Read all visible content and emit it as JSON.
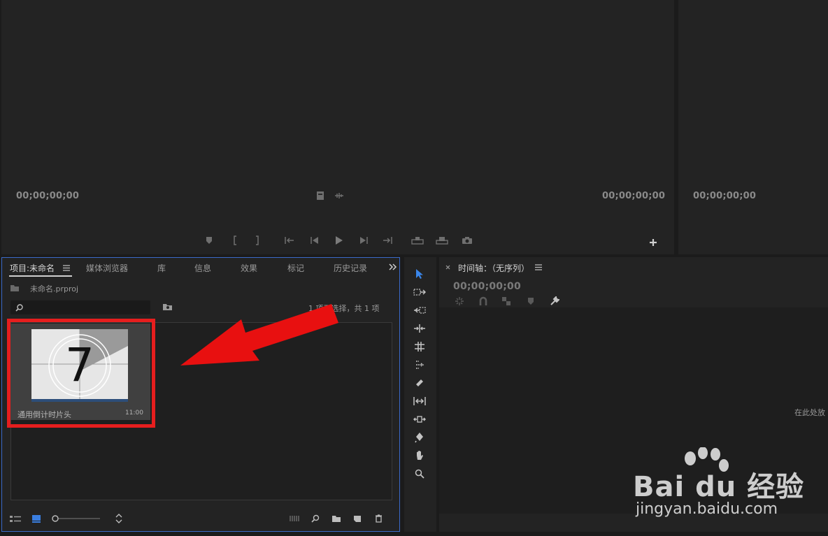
{
  "source_monitor": {
    "timecode_left": "00;00;00;00",
    "timecode_right": "00;00;00;00"
  },
  "program_monitor": {
    "timecode_left": "00;00;00;00"
  },
  "project_panel": {
    "tabs": [
      {
        "label": "项目:未命名"
      },
      {
        "label": "媒体浏览器"
      },
      {
        "label": "库"
      },
      {
        "label": "信息"
      },
      {
        "label": "效果"
      },
      {
        "label": "标记"
      },
      {
        "label": "历史记录"
      }
    ],
    "project_file": "未命名.prproj",
    "search_placeholder": "",
    "selection_status": "1 项已选择，共 1 项",
    "clip": {
      "name": "通用倒计时片头",
      "duration": "11:00",
      "thumbnail_number": "7"
    }
  },
  "timeline_panel": {
    "title": "时间轴：（无序列）",
    "timecode": "00;00;00;00",
    "drop_hint": "在此处放"
  },
  "watermark": {
    "brand": "Bai du 经验",
    "url": "jingyan.baidu.com"
  },
  "colors": {
    "accent_blue": "#3b6ac9",
    "highlight_red": "#e61e1e",
    "panel_bg": "#232323"
  }
}
